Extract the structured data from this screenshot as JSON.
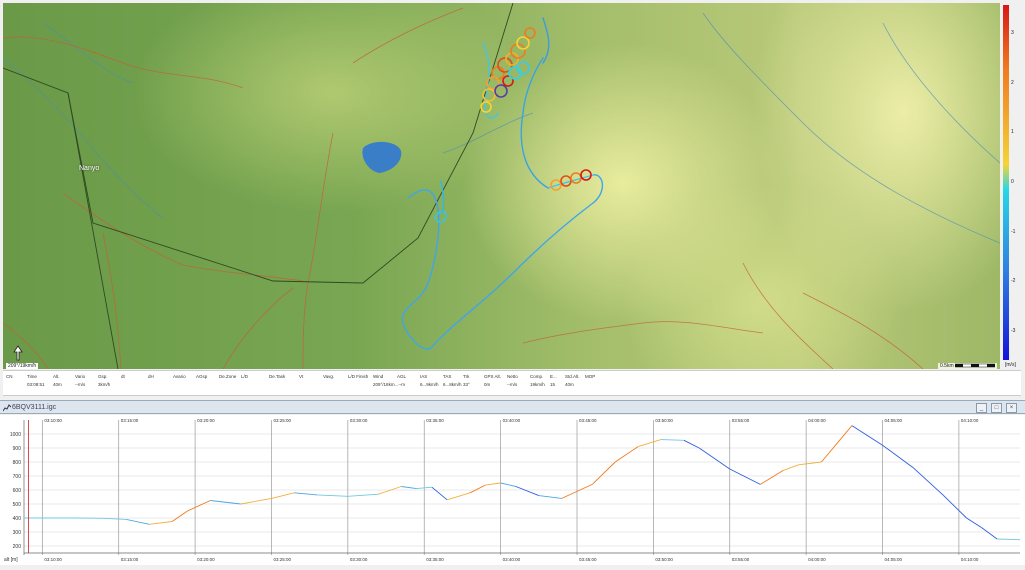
{
  "map": {
    "town": "Nanyo",
    "scale_text": "209°/19km/h",
    "scalebar_label": "0.5km",
    "colorbar": {
      "labels": [
        "3",
        "2",
        "1",
        "0",
        "-1",
        "-2",
        "-3"
      ],
      "unit": "[m/s]",
      "colors": [
        "#d71818",
        "#f07a20",
        "#f5d436",
        "#28d7e6",
        "#2f7ee0",
        "#1414d8"
      ]
    },
    "compass_icon": "compass-arrow-icon"
  },
  "infobar": {
    "headers": [
      "CN",
      "Time",
      "Alt.",
      "Vario",
      "Gsp.",
      "dt",
      "dH",
      "Avario",
      "AGsp",
      "De.Zone",
      "L/D",
      "De.Task",
      "Vt",
      "Vavg.",
      "L/D Finish",
      "Wind",
      "AGL",
      "IAS",
      "TAS",
      "Trk",
      "GPS Alt.",
      "Netto",
      "Comp.",
      "E...",
      "Std.Alt.",
      "MOP"
    ],
    "values": [
      "",
      "03:08:51",
      "40m",
      "--m/s",
      "3km/h",
      "",
      "",
      "",
      "",
      "",
      "",
      "",
      "",
      "",
      "",
      "209°/18km...--m",
      "",
      "6...9km/h",
      "6...8km/h",
      "33°",
      "0m",
      "--m/s",
      "19km/h",
      "15",
      "40m",
      ""
    ]
  },
  "panel": {
    "title": "6BQV3111.igc",
    "buttons": [
      "_",
      "□",
      "×"
    ]
  },
  "chart_data": {
    "type": "line",
    "ylabel": "alt [m]",
    "ylim": [
      150,
      1100
    ],
    "yticks": [
      200,
      300,
      400,
      500,
      600,
      700,
      800,
      900,
      1000
    ],
    "xticks": [
      "03:10:00",
      "03:15:00",
      "03:20:00",
      "03:25:00",
      "03:30:00",
      "03:35:00",
      "03:40:00",
      "03:45:00",
      "03:50:00",
      "03:55:00",
      "04:00:00",
      "04:05:00",
      "04:10:00"
    ],
    "xlim_minutes": [
      8.8,
      74
    ],
    "series": [
      {
        "x": [
          8.8,
          10,
          12,
          14,
          15.5,
          17,
          18.5,
          19.5,
          21,
          23,
          25,
          26.5,
          28,
          30,
          32,
          33.5,
          34.5,
          35.5,
          36.5,
          38,
          39,
          40,
          41,
          42.5,
          44,
          46,
          47.5,
          49,
          50.5,
          52,
          53,
          55,
          57,
          58.5,
          59.5,
          61,
          63,
          65,
          67,
          69,
          70.5,
          71.5,
          72.5,
          74
        ],
        "y": [
          400,
          400,
          400,
          398,
          390,
          355,
          375,
          450,
          525,
          500,
          540,
          580,
          565,
          555,
          570,
          625,
          610,
          620,
          530,
          580,
          635,
          650,
          625,
          560,
          540,
          640,
          800,
          910,
          960,
          955,
          900,
          750,
          640,
          740,
          780,
          800,
          1060,
          920,
          760,
          560,
          400,
          330,
          250,
          245
        ]
      }
    ]
  }
}
